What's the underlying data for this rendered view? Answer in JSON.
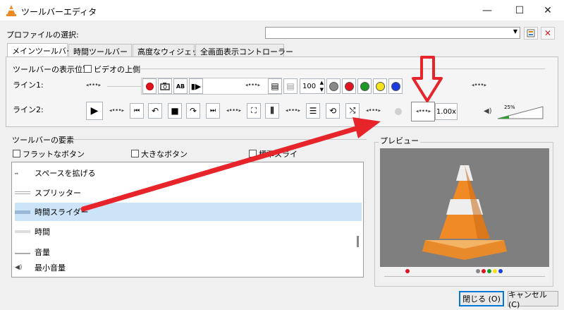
{
  "window": {
    "title": "ツールバーエディタ",
    "minimize": "—",
    "maximize": "☐",
    "close": "✕"
  },
  "profile": {
    "label": "プロファイルの選択:",
    "value": ""
  },
  "tabs": [
    {
      "label": "メインツールバー"
    },
    {
      "label": "時間ツールバー"
    },
    {
      "label": "高度なウィジェット"
    },
    {
      "label": "全画面表示コントローラー"
    }
  ],
  "main_toolbar": {
    "position_label": "ツールバーの表示位置",
    "video_top_label": "ビデオの上側",
    "line1_label": "ライン1:",
    "line2_label": "ライン2:",
    "speed_spin": "100",
    "speed_label": "1.00x",
    "volume_percent": "25%"
  },
  "elements": {
    "group_label": "ツールバーの要素",
    "flat_buttons": "フラットなボタン",
    "big_buttons": "大きなボタン",
    "standard": "標準スライ",
    "items": [
      {
        "label": "スペースを拡げる"
      },
      {
        "label": "スプリッター"
      },
      {
        "label": "時間スライダー"
      },
      {
        "label": "時間"
      },
      {
        "label": "音量"
      },
      {
        "label": "最小音量"
      }
    ]
  },
  "preview": {
    "label": "プレビュー"
  },
  "buttons": {
    "close": "閉じる (O)",
    "cancel": "キャンセル (C)"
  },
  "colors": {
    "annotation_red": "#e8242b",
    "selection": "#cce4f7",
    "vlc_orange": "#f08a24"
  }
}
